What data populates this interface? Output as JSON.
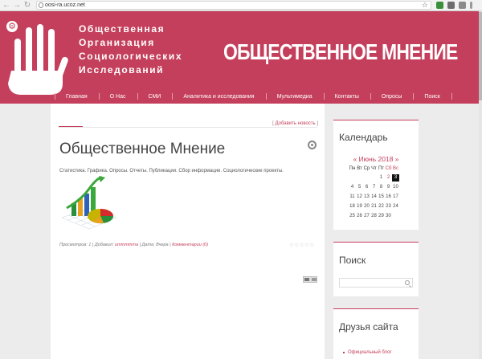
{
  "browser": {
    "url": "oosi-ra.ucoz.net",
    "back_glyph": "←",
    "forward_glyph": "→",
    "reload_glyph": "↻",
    "star_glyph": "☆"
  },
  "header": {
    "org_lines": [
      "Общественная",
      "Организация",
      "Социологических",
      "Исследований"
    ],
    "big_title": "ОБЩЕСТВЕННОЕ МНЕНИЕ",
    "gear_glyph": "⚙",
    "brand_color": "#c43f5b"
  },
  "menu": {
    "items": [
      "Главная",
      "О Нас",
      "СМИ",
      "Аналитика и исследования",
      "Мультимедиа",
      "Контакты",
      "Опросы",
      "Поиск"
    ]
  },
  "main": {
    "add_news": "Добавить новость",
    "title": "Общественное Мнение",
    "desc": "Статистика. Графика. Опросы. Отчеты. Публикации. Сбор информации. Социологические проекты.",
    "meta": {
      "views_label": "Просмотров:",
      "views_value": "1",
      "added_label": "Добавил:",
      "added_value": "ummmmma",
      "date_label": "Дата:",
      "date_value": "Вчера",
      "comments": "Комментарии (0)"
    },
    "rating_stars": 5
  },
  "sidebar": {
    "calendar_title": "Календарь",
    "month": "« Июнь 2018 »",
    "weekdays": [
      "Пн",
      "Вт",
      "Ср",
      "Чт",
      "Пт",
      "Сб",
      "Вс"
    ],
    "weeks": [
      [
        "",
        "",
        "",
        "",
        "1",
        "2",
        "3"
      ],
      [
        "4",
        "5",
        "6",
        "7",
        "8",
        "9",
        "10"
      ],
      [
        "11",
        "12",
        "13",
        "14",
        "15",
        "16",
        "17"
      ],
      [
        "18",
        "19",
        "20",
        "21",
        "22",
        "23",
        "24"
      ],
      [
        "25",
        "26",
        "27",
        "28",
        "29",
        "30",
        ""
      ]
    ],
    "search_title": "Поиск",
    "friends_title": "Друзья сайта",
    "friends_link": "Официальный блог"
  }
}
